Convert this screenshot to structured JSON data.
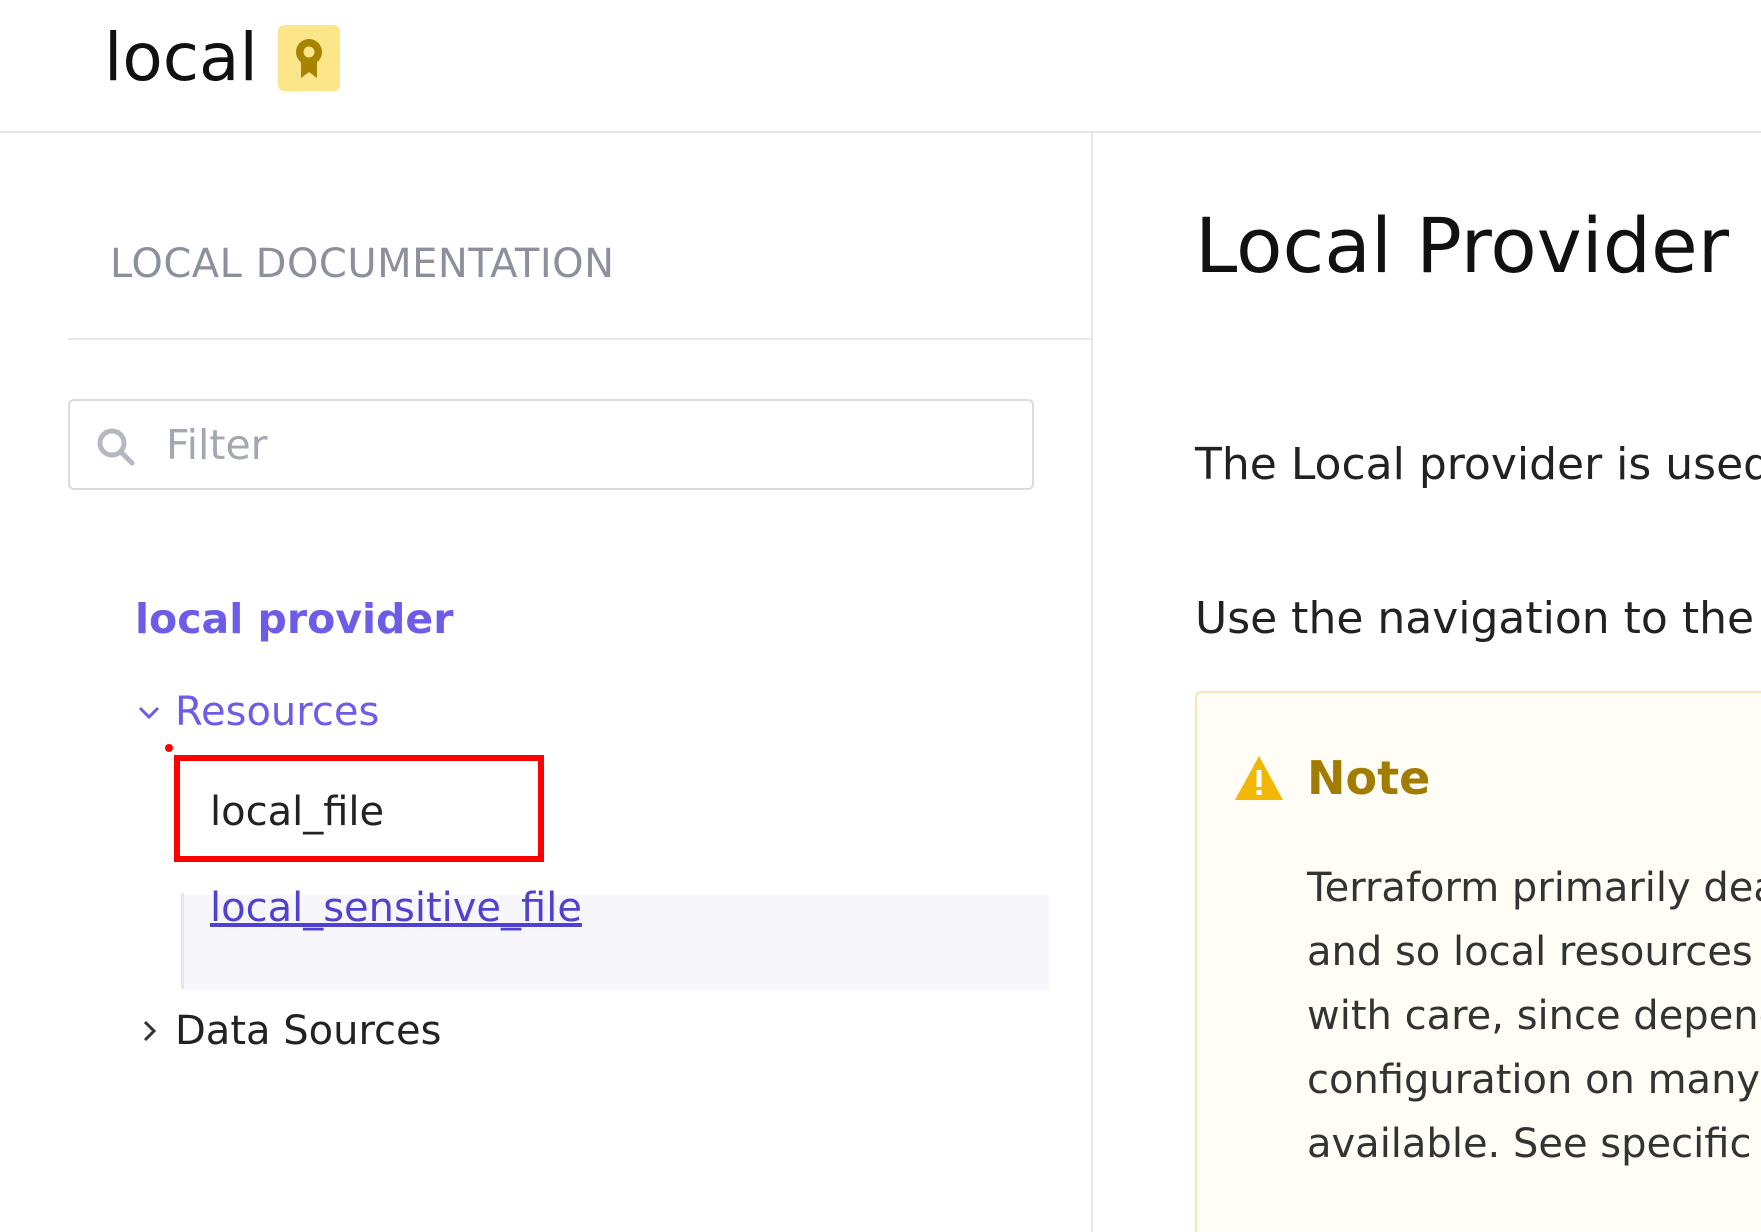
{
  "header": {
    "title": "local",
    "badge_icon": "award-badge-icon"
  },
  "sidebar": {
    "heading": "LOCAL DOCUMENTATION",
    "filter": {
      "placeholder": "Filter",
      "value": ""
    },
    "provider_link": "local provider",
    "resources": {
      "label": "Resources",
      "expanded": true,
      "items": [
        {
          "label": "local_file"
        },
        {
          "label": "local_sensitive_file"
        }
      ]
    },
    "data_sources": {
      "label": "Data Sources",
      "expanded": false
    }
  },
  "main": {
    "title": "Local Provider",
    "paragraphs": [
      "The Local provider is used t",
      "Use the navigation to the le"
    ],
    "note": {
      "title": "Note",
      "lines": [
        "Terraform primarily deals",
        "and so local resources ca",
        "with care, since dependin",
        "configuration on many d",
        "available. See specific no"
      ]
    }
  },
  "colors": {
    "accent": "#6c5ce7",
    "link": "#5141cf",
    "highlight": "#ff0000",
    "note_title": "#a27c00",
    "badge_bg": "#fde68a"
  }
}
